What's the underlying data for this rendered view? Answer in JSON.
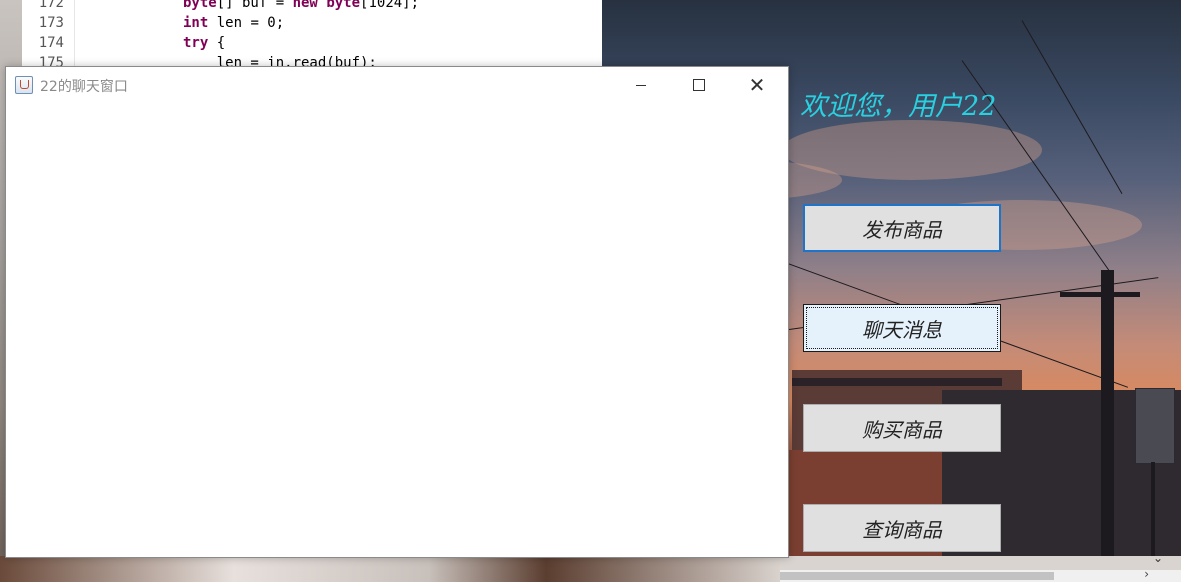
{
  "editor": {
    "lines": [
      {
        "num": "172",
        "code_parts": [
          {
            "t": "byte",
            "k": true
          },
          {
            "t": "[] buf = ",
            "k": false
          },
          {
            "t": "new",
            "k": true
          },
          {
            "t": " ",
            "k": false
          },
          {
            "t": "byte",
            "k": true
          },
          {
            "t": "[1024];",
            "k": false
          }
        ]
      },
      {
        "num": "173",
        "code_parts": [
          {
            "t": "int",
            "k": true
          },
          {
            "t": " len = 0;",
            "k": false
          }
        ]
      },
      {
        "num": "174",
        "code_parts": [
          {
            "t": "try",
            "k": true
          },
          {
            "t": " {",
            "k": false
          }
        ]
      },
      {
        "num": "175",
        "code_parts": [
          {
            "t": "    len = in.read(buf);",
            "k": false
          }
        ]
      }
    ]
  },
  "main_window": {
    "welcome": "欢迎您，用户22",
    "buttons": [
      {
        "label": "发布商品",
        "state": "focused"
      },
      {
        "label": "聊天消息",
        "state": "hovered"
      },
      {
        "label": "购买商品",
        "state": "normal"
      },
      {
        "label": "查询商品",
        "state": "normal"
      }
    ]
  },
  "chat_window": {
    "title": "22的聊天窗口",
    "controls": {
      "minimize": "minimize",
      "maximize": "maximize",
      "close": "✕"
    }
  },
  "colors": {
    "welcome": "#29d1e0",
    "focus_border": "#1e74c9",
    "hover_bg": "#e5f1fb"
  }
}
